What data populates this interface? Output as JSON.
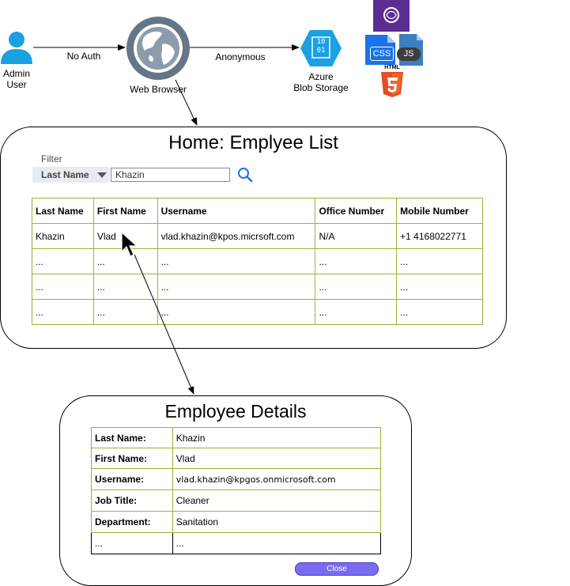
{
  "top_flow": {
    "admin_label": "Admin\nUser",
    "no_auth_label": "No Auth",
    "web_browser_label": "Web Browser",
    "anonymous_label": "Anonymous",
    "azure_label": "Azure\nBlob Storage",
    "storage_icon_text": "10\n01",
    "css_text": "CSS",
    "js_text": "JS",
    "html_text": "HTML"
  },
  "home": {
    "title": "Home: Emplyee List",
    "filter_label": "Filter",
    "filter_field": "Last Name",
    "search_value": "Khazin",
    "columns": [
      "Last Name",
      "First Name",
      "Username",
      "Office Number",
      "Mobile Number"
    ],
    "rows": [
      [
        "Khazin",
        "Vlad",
        "vlad.khazin@kpos.micrsoft.com",
        "N/A",
        "+1 4168022771"
      ],
      [
        "...",
        "...",
        "...",
        "...",
        "..."
      ],
      [
        "...",
        "...",
        "...",
        "...",
        "..."
      ],
      [
        "...",
        "...",
        "...",
        "...",
        "..."
      ]
    ]
  },
  "details": {
    "title": "Employee Details",
    "fields": [
      {
        "label": "Last Name:",
        "value": "Khazin"
      },
      {
        "label": "First Name:",
        "value": "Vlad"
      },
      {
        "label": "Username:",
        "value": "vlad.khazin@kpgos.onmicrosoft.com"
      },
      {
        "label": "Job Title:",
        "value": "Cleaner"
      },
      {
        "label": "Department:",
        "value": "Sanitation"
      },
      {
        "label": "...",
        "value": "..."
      }
    ],
    "close_label": "Close"
  },
  "colors": {
    "admin_icon": "#1ba1e2",
    "globe": "#647687",
    "azure": "#1ba1e2",
    "css": "#1a73e8",
    "js": "#3c7fc0",
    "html5": "#e44d26",
    "visual_studio": "#5c2d91",
    "table_border": "#9ab23a",
    "close_button": "#7a6cf0"
  },
  "icons": [
    "admin-user-icon",
    "web-browser-icon",
    "azure-blob-storage-icon",
    "visual-studio-icon",
    "css-file-icon",
    "js-file-icon",
    "html5-icon",
    "search-icon",
    "mouse-cursor-icon"
  ]
}
